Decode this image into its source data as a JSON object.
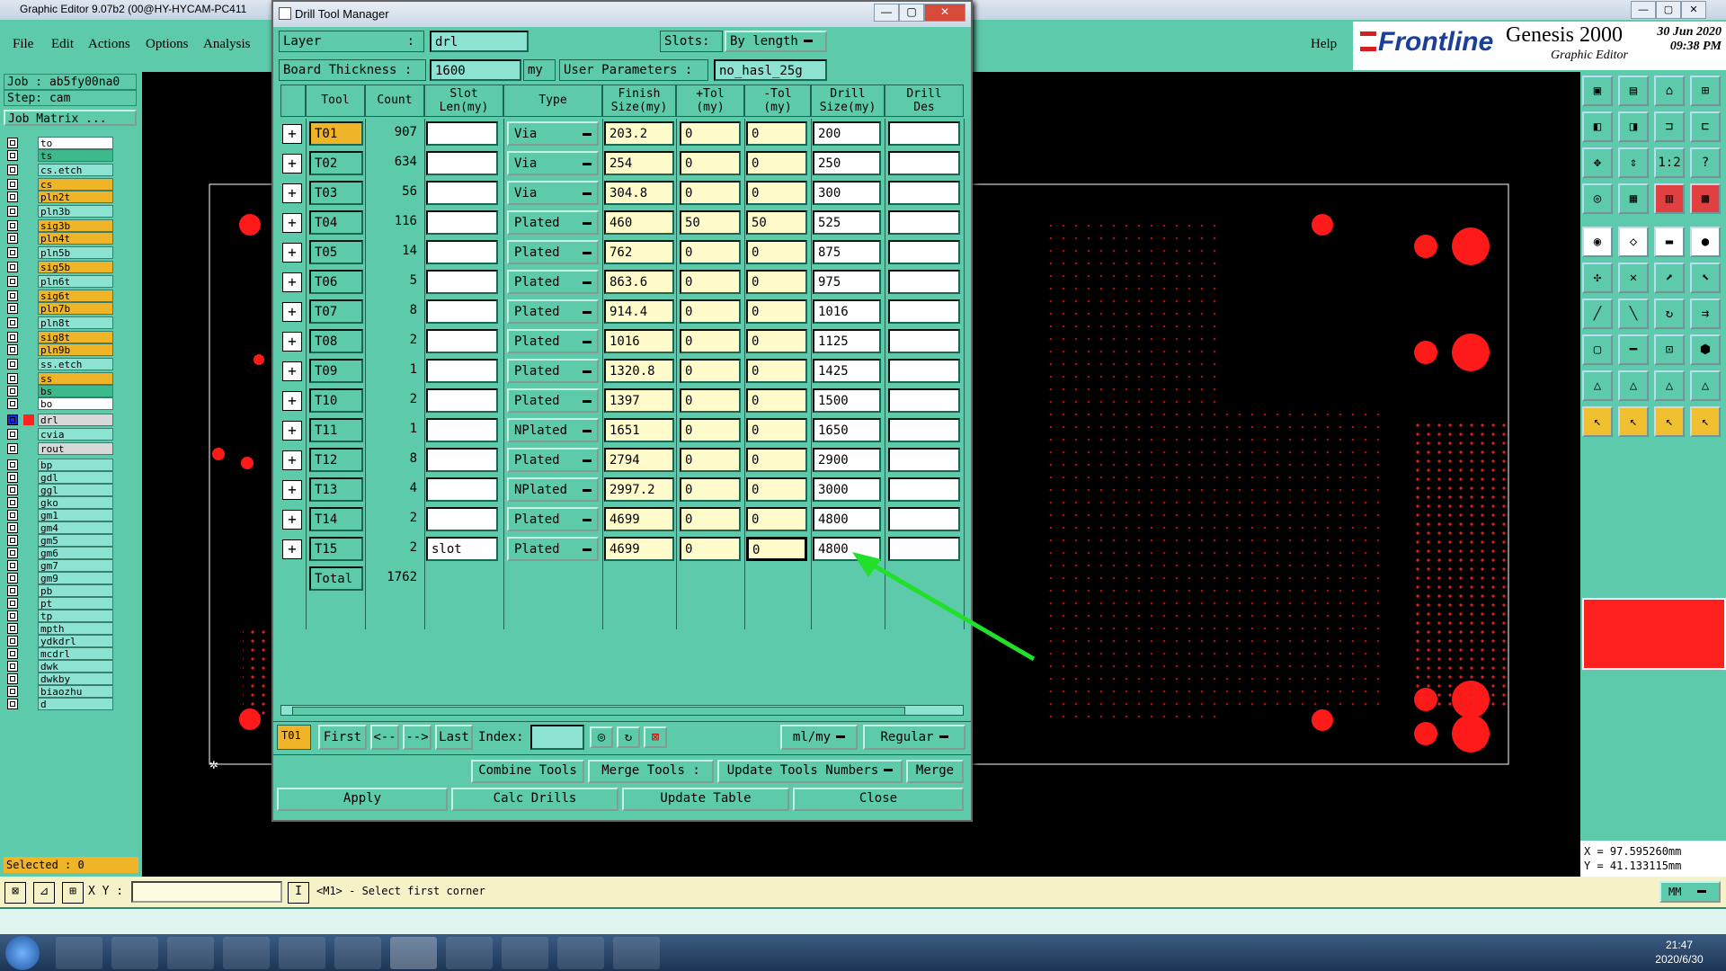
{
  "main_window": {
    "title": "Graphic Editor 9.07b2 (00@HY-HYCAM-PC411",
    "min": "—",
    "max": "▢",
    "close": "✕"
  },
  "menu": [
    "File",
    "Edit",
    "Actions",
    "Options",
    "Analysis"
  ],
  "help": "Help",
  "logo": {
    "brand": "Frontline",
    "product": "Genesis 2000",
    "sub": "Graphic Editor",
    "date": "30 Jun 2020",
    "time": "09:38 PM"
  },
  "job": {
    "job": "Job : ab5fy00na0",
    "step": "Step: cam",
    "matrix": "Job Matrix ..."
  },
  "layers": [
    {
      "name": "to",
      "style": "w",
      "arrow": "⬋"
    },
    {
      "name": "ts",
      "style": "g",
      "arrow": ""
    },
    {
      "name": "cs.etch",
      "style": "",
      "arrow": ""
    },
    {
      "name": "cs",
      "style": "o",
      "arrow": "⬋"
    },
    {
      "name": "pln2t",
      "style": "o",
      "arrow": "⬋"
    },
    {
      "name": "pln3b",
      "style": "",
      "arrow": ""
    },
    {
      "name": "sig3b",
      "style": "o",
      "arrow": "⬋"
    },
    {
      "name": "pln4t",
      "style": "o",
      "arrow": "⬋"
    },
    {
      "name": "pln5b",
      "style": "",
      "arrow": ""
    },
    {
      "name": "sig5b",
      "style": "o",
      "arrow": "⬋"
    },
    {
      "name": "pln6t",
      "style": "",
      "arrow": ""
    },
    {
      "name": "sig6t",
      "style": "o",
      "arrow": "⬋"
    },
    {
      "name": "pln7b",
      "style": "o",
      "arrow": "⬋"
    },
    {
      "name": "pln8t",
      "style": "",
      "arrow": ""
    },
    {
      "name": "sig8t",
      "style": "o",
      "arrow": "⬋"
    },
    {
      "name": "pln9b",
      "style": "o",
      "arrow": "⬋"
    },
    {
      "name": "ss.etch",
      "style": "",
      "arrow": ""
    },
    {
      "name": "ss",
      "style": "o",
      "arrow": "⬋"
    },
    {
      "name": "bs",
      "style": "g",
      "arrow": ""
    },
    {
      "name": "bo",
      "style": "w",
      "arrow": "⬋"
    },
    {
      "name": "drl",
      "style": "gr",
      "arrow": "▪"
    },
    {
      "name": "cvia",
      "style": "",
      "arrow": ""
    },
    {
      "name": "rout",
      "style": "gr",
      "arrow": ""
    },
    {
      "name": "bp",
      "style": "",
      "arrow": ""
    },
    {
      "name": "gdl",
      "style": "",
      "arrow": "⬋"
    },
    {
      "name": "ggl",
      "style": "",
      "arrow": ""
    },
    {
      "name": "gko",
      "style": "",
      "arrow": ""
    },
    {
      "name": "gm1",
      "style": "",
      "arrow": ""
    },
    {
      "name": "gm4",
      "style": "",
      "arrow": ""
    },
    {
      "name": "gm5",
      "style": "",
      "arrow": ""
    },
    {
      "name": "gm6",
      "style": "",
      "arrow": ""
    },
    {
      "name": "gm7",
      "style": "",
      "arrow": ""
    },
    {
      "name": "gm9",
      "style": "",
      "arrow": ""
    },
    {
      "name": "pb",
      "style": "",
      "arrow": ""
    },
    {
      "name": "pt",
      "style": "",
      "arrow": ""
    },
    {
      "name": "tp",
      "style": "",
      "arrow": ""
    },
    {
      "name": "mpth",
      "style": "",
      "arrow": ""
    },
    {
      "name": "ydkdrl",
      "style": "",
      "arrow": ""
    },
    {
      "name": "mcdrl",
      "style": "",
      "arrow": ""
    },
    {
      "name": "dwk",
      "style": "",
      "arrow": ""
    },
    {
      "name": "dwkby",
      "style": "",
      "arrow": ""
    },
    {
      "name": "biaozhu",
      "style": "",
      "arrow": ""
    },
    {
      "name": "d",
      "style": "",
      "arrow": ""
    }
  ],
  "selected": "Selected : 0",
  "dialog": {
    "title": "Drill Tool Manager",
    "layer_label": "Layer",
    "layer_sep": ":",
    "layer_value": "drl",
    "slots_label": "Slots:",
    "slots_value": "By length",
    "board_thickness_label": "Board Thickness :",
    "board_thickness_value": "1600",
    "board_thickness_unit": "my",
    "user_params_label": "User Parameters :",
    "user_params_value": "no_hasl_25g",
    "headers": {
      "tool": "Tool",
      "count": "Count",
      "slot": "Slot\nLen(my)",
      "type": "Type",
      "finish": "Finish\nSize(my)",
      "ptol": "+Tol\n(my)",
      "mtol": "-Tol\n(my)",
      "drill": "Drill\nSize(my)",
      "des": "Drill\nDes"
    },
    "rows": [
      {
        "tool": "T01",
        "count": "907",
        "slot": "",
        "type": "Via",
        "finish": "203.2",
        "ptol": "0",
        "mtol": "0",
        "drill": "200",
        "des": ""
      },
      {
        "tool": "T02",
        "count": "634",
        "slot": "",
        "type": "Via",
        "finish": "254",
        "ptol": "0",
        "mtol": "0",
        "drill": "250",
        "des": ""
      },
      {
        "tool": "T03",
        "count": "56",
        "slot": "",
        "type": "Via",
        "finish": "304.8",
        "ptol": "0",
        "mtol": "0",
        "drill": "300",
        "des": ""
      },
      {
        "tool": "T04",
        "count": "116",
        "slot": "",
        "type": "Plated",
        "finish": "460",
        "ptol": "50",
        "mtol": "50",
        "drill": "525",
        "des": ""
      },
      {
        "tool": "T05",
        "count": "14",
        "slot": "",
        "type": "Plated",
        "finish": "762",
        "ptol": "0",
        "mtol": "0",
        "drill": "875",
        "des": ""
      },
      {
        "tool": "T06",
        "count": "5",
        "slot": "",
        "type": "Plated",
        "finish": "863.6",
        "ptol": "0",
        "mtol": "0",
        "drill": "975",
        "des": ""
      },
      {
        "tool": "T07",
        "count": "8",
        "slot": "",
        "type": "Plated",
        "finish": "914.4",
        "ptol": "0",
        "mtol": "0",
        "drill": "1016",
        "des": ""
      },
      {
        "tool": "T08",
        "count": "2",
        "slot": "",
        "type": "Plated",
        "finish": "1016",
        "ptol": "0",
        "mtol": "0",
        "drill": "1125",
        "des": ""
      },
      {
        "tool": "T09",
        "count": "1",
        "slot": "",
        "type": "Plated",
        "finish": "1320.8",
        "ptol": "0",
        "mtol": "0",
        "drill": "1425",
        "des": ""
      },
      {
        "tool": "T10",
        "count": "2",
        "slot": "",
        "type": "Plated",
        "finish": "1397",
        "ptol": "0",
        "mtol": "0",
        "drill": "1500",
        "des": ""
      },
      {
        "tool": "T11",
        "count": "1",
        "slot": "",
        "type": "NPlated",
        "finish": "1651",
        "ptol": "0",
        "mtol": "0",
        "drill": "1650",
        "des": ""
      },
      {
        "tool": "T12",
        "count": "8",
        "slot": "",
        "type": "Plated",
        "finish": "2794",
        "ptol": "0",
        "mtol": "0",
        "drill": "2900",
        "des": ""
      },
      {
        "tool": "T13",
        "count": "4",
        "slot": "",
        "type": "NPlated",
        "finish": "2997.2",
        "ptol": "0",
        "mtol": "0",
        "drill": "3000",
        "des": ""
      },
      {
        "tool": "T14",
        "count": "2",
        "slot": "",
        "type": "Plated",
        "finish": "4699",
        "ptol": "0",
        "mtol": "0",
        "drill": "4800",
        "des": ""
      },
      {
        "tool": "T15",
        "count": "2",
        "slot": "slot",
        "type": "Plated",
        "finish": "4699",
        "ptol": "0",
        "mtol": "0",
        "drill": "4800",
        "des": ""
      }
    ],
    "total_label": "Total",
    "total_value": "1762",
    "nav": {
      "current": "T01",
      "first": "First",
      "prev": "<--",
      "next": "-->",
      "last": "Last",
      "index": "Index:",
      "units": "ml/my",
      "mode": "Regular"
    },
    "actions1": [
      "Combine Tools",
      "Merge Tools :",
      "Update Tools Numbers",
      "Merge"
    ],
    "actions2": [
      "Apply",
      "Calc Drills",
      "Update Table",
      "Close"
    ]
  },
  "coords": {
    "x": "X = 97.595260mm",
    "y": "Y = 41.133115mm"
  },
  "status": {
    "xy": "X Y :",
    "msg": "<M1> - Select first corner",
    "units": "MM"
  },
  "clock": {
    "time": "21:47",
    "date": "2020/6/30"
  }
}
